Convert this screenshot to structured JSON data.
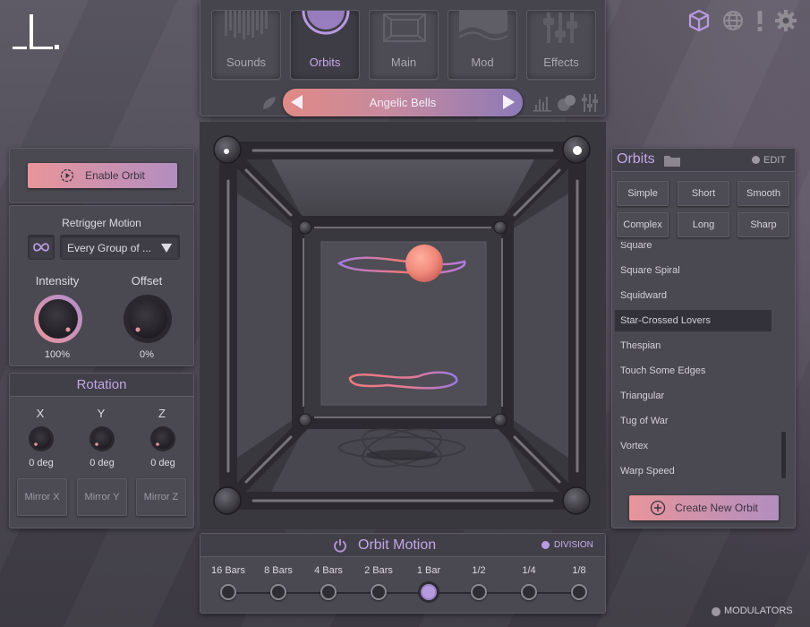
{
  "nav": {
    "tabs": [
      {
        "label": "Sounds"
      },
      {
        "label": "Orbits"
      },
      {
        "label": "Main"
      },
      {
        "label": "Mod"
      },
      {
        "label": "Effects"
      }
    ],
    "active_tab": "Orbits",
    "preset_name": "Angelic Bells"
  },
  "top_icons": [
    "cube-icon",
    "globe-icon",
    "alert-icon",
    "gear-icon"
  ],
  "enable_orbit": {
    "label": "Enable Orbit"
  },
  "retrigger": {
    "title": "Retrigger Motion",
    "mode": "Every Group of ..."
  },
  "intensity": {
    "label": "Intensity",
    "value": "100%",
    "level": 1.0
  },
  "offset": {
    "label": "Offset",
    "value": "0%",
    "level": 0.0
  },
  "rotation": {
    "title": "Rotation",
    "axes": [
      {
        "label": "X",
        "value": "0 deg"
      },
      {
        "label": "Y",
        "value": "0 deg"
      },
      {
        "label": "Z",
        "value": "0 deg"
      }
    ],
    "mirror": [
      "Mirror X",
      "Mirror Y",
      "Mirror Z"
    ]
  },
  "orbits_panel": {
    "title": "Orbits",
    "edit_label": "EDIT",
    "filters": [
      "Simple",
      "Short",
      "Smooth",
      "Complex",
      "Long",
      "Sharp"
    ],
    "items": [
      "Square",
      "Square Spiral",
      "Squidward",
      "Star-Crossed Lovers",
      "Thespian",
      "Touch Some Edges",
      "Triangular",
      "Tug of War",
      "Vortex",
      "Warp Speed"
    ],
    "selected": "Star-Crossed Lovers",
    "create_label": "Create New Orbit"
  },
  "orbit_motion": {
    "title": "Orbit Motion",
    "division_label": "DIVISION",
    "divisions": [
      "16 Bars",
      "8 Bars",
      "4 Bars",
      "2 Bars",
      "1 Bar",
      "1/2",
      "1/4",
      "1/8"
    ],
    "selected": "1 Bar"
  },
  "modulators_label": "MODULATORS",
  "colors": {
    "accent_purple": "#b89ae0",
    "accent_pink": "#e8959a",
    "orb": "#f0887a"
  }
}
